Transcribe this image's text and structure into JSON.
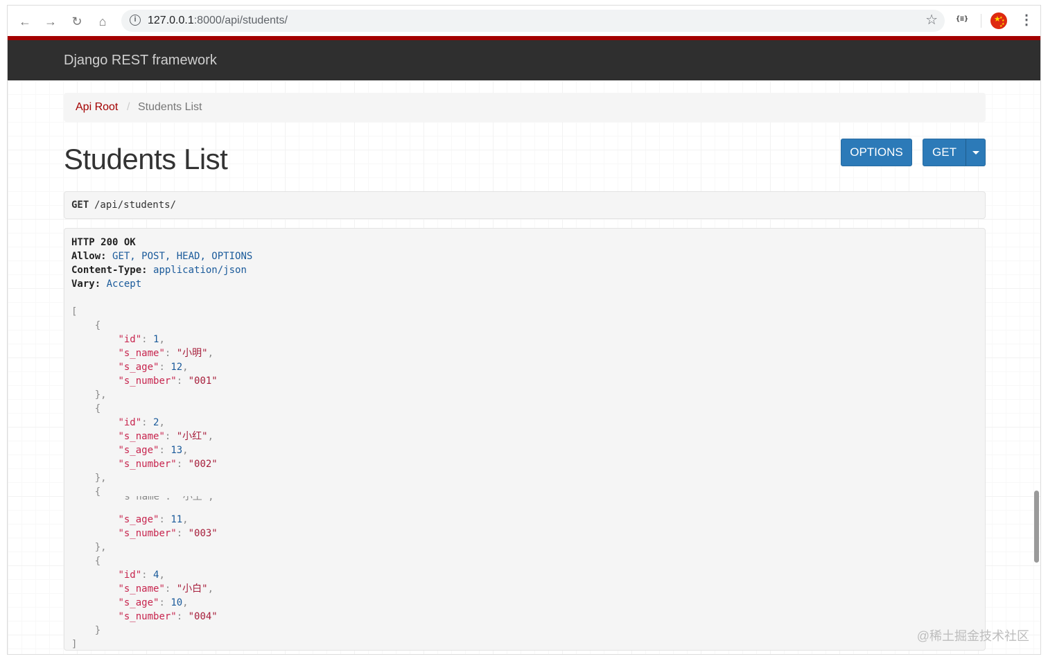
{
  "browser": {
    "url_host": "127.0.0.1",
    "url_rest": ":8000/api/students/",
    "ext_label": "{≡}",
    "icons": [
      "back-icon",
      "forward-icon",
      "reload-icon",
      "home-icon",
      "info-icon",
      "star-icon",
      "extension-icon",
      "profile-flag-icon",
      "menu-icon"
    ]
  },
  "navbar": {
    "brand": "Django REST framework"
  },
  "breadcrumb": {
    "root": "Api Root",
    "separator": "/",
    "current": "Students List"
  },
  "page": {
    "title": "Students List"
  },
  "buttons": {
    "options": "OPTIONS",
    "get": "GET"
  },
  "request": {
    "method": "GET",
    "path": "/api/students/"
  },
  "response": {
    "status": "HTTP 200 OK",
    "headers": [
      {
        "key": "Allow:",
        "value": "GET, POST, HEAD, OPTIONS"
      },
      {
        "key": "Content-Type:",
        "value": "application/json"
      },
      {
        "key": "Vary:",
        "value": "Accept"
      }
    ],
    "students": [
      {
        "id": 1,
        "s_name": "小明",
        "s_age": 12,
        "s_number": "001"
      },
      {
        "id": 2,
        "s_name": "小红",
        "s_age": 13,
        "s_number": "002"
      },
      {
        "id": null,
        "s_name": null,
        "s_age": 11,
        "s_number": "003"
      },
      {
        "id": 4,
        "s_name": "小白",
        "s_age": 10,
        "s_number": "004"
      }
    ]
  },
  "watermark": "@稀土掘金技术社区"
}
